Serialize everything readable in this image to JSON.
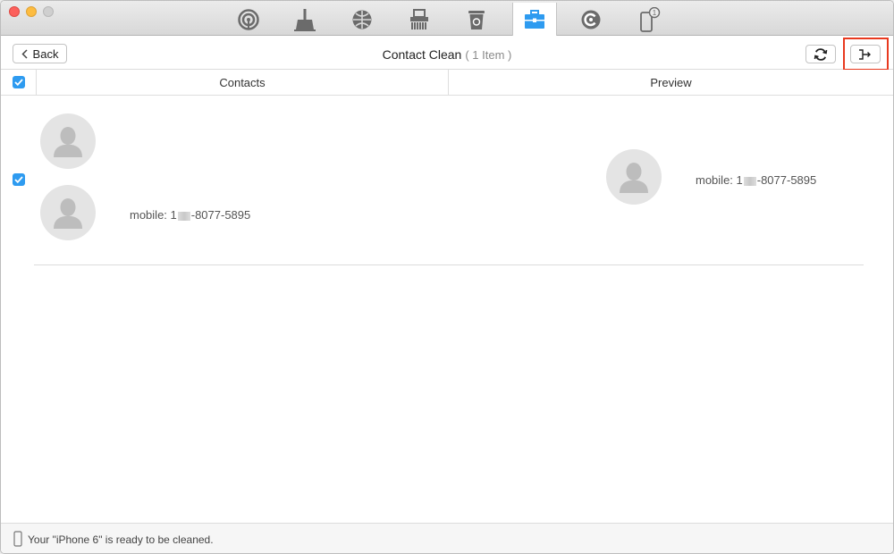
{
  "tabs": [
    {
      "icon": "signal-icon"
    },
    {
      "icon": "broom-icon"
    },
    {
      "icon": "globe-icon"
    },
    {
      "icon": "shredder-icon"
    },
    {
      "icon": "recycle-bin-icon"
    },
    {
      "icon": "toolbox-icon",
      "active": true
    },
    {
      "icon": "c-logo-icon"
    },
    {
      "icon": "iphone-badge-icon",
      "badge": "1"
    }
  ],
  "toolbar": {
    "back_label": "Back",
    "title": "Contact Clean",
    "count": "( 1 Item )"
  },
  "table": {
    "columns": [
      "Contacts",
      "Preview"
    ]
  },
  "row": {
    "contact_phone_prefix": "mobile: 1",
    "contact_phone_suffix": "-8077-5895",
    "preview_phone_prefix": "mobile: 1",
    "preview_phone_suffix": "-8077-5895"
  },
  "status": {
    "text": "Your \"iPhone 6\" is ready to be cleaned."
  },
  "colors": {
    "accent": "#2e9bf0",
    "highlight": "#e8391f"
  }
}
